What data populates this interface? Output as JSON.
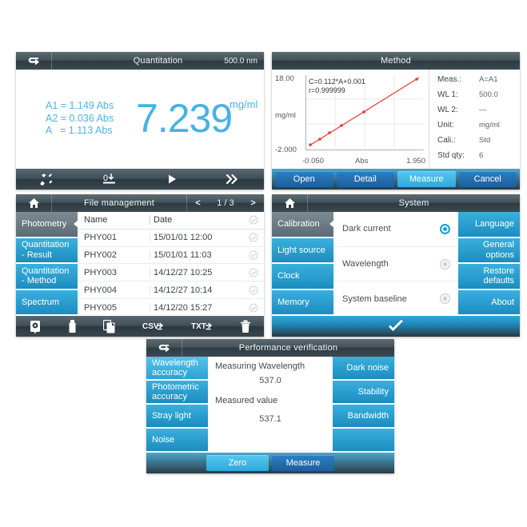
{
  "quantitation": {
    "header": {
      "back_icon": "back-arrow-icon",
      "title": "Quantitation",
      "wavelength": "500.0 nm"
    },
    "readings": "A1 = 1.149 Abs\nA2 = 0.036 Abs\nA   = 1.113 Abs",
    "value": "7.239",
    "unit": "mg/ml",
    "toolbar": [
      {
        "icon": "tools-icon",
        "name": "settings-tools"
      },
      {
        "icon": "zero-icon",
        "name": "zero-baseline"
      },
      {
        "icon": "play-icon",
        "name": "measure-start"
      },
      {
        "icon": "double-chevron-right-icon",
        "name": "more-options"
      }
    ]
  },
  "method": {
    "header": {
      "title": "Method"
    },
    "chart": {
      "y_top": "18.00",
      "y_label": "mg/ml",
      "y_bottom": "-2.000",
      "x_left": "-0.050",
      "x_label": "Abs",
      "x_right": "1.950",
      "equation": "C=0.112*A+0.001",
      "correlation": "r=0.999999"
    },
    "params": [
      {
        "key": "Meas.:",
        "value": "A=A1"
      },
      {
        "key": "WL 1:",
        "value": "500.0"
      },
      {
        "key": "WL 2:",
        "value": "—"
      },
      {
        "key": "Unit:",
        "value": "mg/ml"
      },
      {
        "key": "Cali.:",
        "value": "Std"
      },
      {
        "key": "Std qty:",
        "value": "6"
      }
    ],
    "buttons": [
      {
        "label": "Open",
        "selected": false
      },
      {
        "label": "Detail",
        "selected": false
      },
      {
        "label": "Measure",
        "selected": true
      },
      {
        "label": "Cancel",
        "selected": false
      }
    ]
  },
  "files": {
    "header": {
      "home_icon": "home-icon",
      "title": "File management",
      "prev": "<",
      "page": "1 / 3",
      "next": ">"
    },
    "tabs": [
      {
        "label": "Photometry",
        "selected": true
      },
      {
        "label": "Quantitation\n- Result",
        "selected": false
      },
      {
        "label": "Quantitation\n- Method",
        "selected": false
      },
      {
        "label": "Spectrum",
        "selected": false
      }
    ],
    "columns": {
      "name": "Name",
      "date": "Date"
    },
    "rows": [
      {
        "name": "PHY001",
        "date": "15/01/01 12:00"
      },
      {
        "name": "PHY002",
        "date": "15/01/01 11:03"
      },
      {
        "name": "PHY003",
        "date": "14/12/27 10:25"
      },
      {
        "name": "PHY004",
        "date": "14/12/27 10:14"
      },
      {
        "name": "PHY005",
        "date": "14/12/20 15:27"
      }
    ],
    "toolbar": [
      {
        "icon": "internal-disk-icon",
        "name": "save-internal"
      },
      {
        "icon": "usb-drive-icon",
        "name": "save-usb"
      },
      {
        "icon": "copy-file-icon",
        "name": "copy-file"
      },
      {
        "icon": "csv-export-icon",
        "name": "export-csv"
      },
      {
        "icon": "txt-export-icon",
        "name": "export-txt"
      },
      {
        "icon": "trash-icon",
        "name": "delete-file"
      }
    ]
  },
  "system": {
    "header": {
      "home_icon": "home-icon",
      "title": "System"
    },
    "left_tabs": [
      {
        "label": "Calibration",
        "selected": true
      },
      {
        "label": "Light source",
        "selected": false
      },
      {
        "label": "Clock",
        "selected": false
      },
      {
        "label": "Memory",
        "selected": false
      }
    ],
    "options": [
      {
        "label": "Dark current",
        "selected": true
      },
      {
        "label": "Wavelength",
        "selected": false
      },
      {
        "label": "System baseline",
        "selected": false
      }
    ],
    "right_tabs": [
      {
        "label": "Language"
      },
      {
        "label": "General\noptions"
      },
      {
        "label": "Restore\ndefaults"
      },
      {
        "label": "About"
      }
    ],
    "confirm_icon": "checkmark-icon"
  },
  "performance": {
    "header": {
      "back_icon": "back-arrow-icon",
      "title": "Performance verification"
    },
    "left_tabs": [
      {
        "label": "Wavelength\naccuracy",
        "selected": true
      },
      {
        "label": "Photometric\naccuracy",
        "selected": false
      },
      {
        "label": "Stray light",
        "selected": false
      },
      {
        "label": "Noise",
        "selected": false
      }
    ],
    "right_tabs": [
      {
        "label": "Dark noise"
      },
      {
        "label": "Stability"
      },
      {
        "label": "Bandwidth"
      },
      {
        "label": ""
      }
    ],
    "measuring_label": "Measuring Wavelength",
    "measuring_value": "537.0",
    "measured_label": "Measured value",
    "measured_value": "537.1",
    "buttons": [
      {
        "label": "Zero",
        "selected": true
      },
      {
        "label": "Measure",
        "selected": false
      }
    ]
  },
  "colors": {
    "accent_blue": "#2ba3d6",
    "text_blue": "#45b3e6",
    "header_dark": "#2f3b43",
    "curve_red": "#e8392f"
  }
}
